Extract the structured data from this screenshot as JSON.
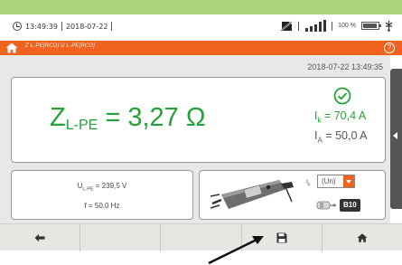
{
  "status": {
    "time": "13:49:39",
    "date": "2018-07-22",
    "battery_percent": "100 %"
  },
  "header": {
    "title": "Z L-PE[RCD] U L-PE[RCD]"
  },
  "measurement": {
    "timestamp": "2018-07-22 13:49:35",
    "z_symbol": "Z",
    "z_sub": "L-PE",
    "z_value": " = 3,27 Ω",
    "ik_symbol": "I",
    "ik_sub": "k",
    "ik_value": " = 70,4 A",
    "ia_symbol": "I",
    "ia_sub": "A",
    "ia_value": " = 50,0 A",
    "u_symbol": "U",
    "u_sub": "L-PE",
    "u_value": " = 239,5 V",
    "freq": "f = 50,0 Hz"
  },
  "settings": {
    "ik_label_symbol": "I",
    "ik_label_sub": "k",
    "ik_mode": "(Un)",
    "fuse_type": "B10"
  },
  "colors": {
    "accent_orange": "#f0621e",
    "result_green": "#22a336",
    "top_band": "#a9d47a"
  },
  "icons": {
    "status_left": [
      "clock-icon"
    ],
    "status_right": [
      "no-sim-icon",
      "signal-bars-icon",
      "battery-icon",
      "usb-icon"
    ],
    "toolbar": [
      "back-arrow-icon",
      "save-icon",
      "home-icon"
    ]
  }
}
